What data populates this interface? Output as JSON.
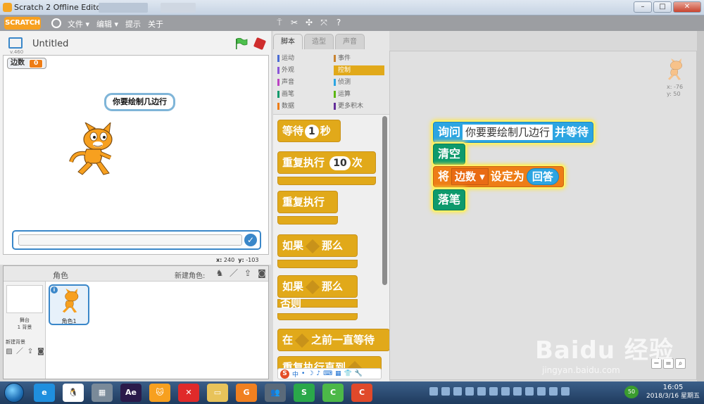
{
  "window": {
    "title": "Scratch 2 Offline Editor",
    "controls": [
      "–",
      "□",
      "✕"
    ]
  },
  "menubar": {
    "logo": "SCRATCH",
    "items": [
      "文件 ▾",
      "编辑 ▾",
      "提示",
      "关于"
    ],
    "tools": [
      "duplicate-icon",
      "delete-icon",
      "grow-icon",
      "shrink-icon",
      "help-icon"
    ]
  },
  "stage": {
    "project_title": "Untitled",
    "version": "v.460",
    "variable": {
      "name": "边数",
      "value": "0"
    },
    "speech_bubble": "你要绘制几边行",
    "coords": {
      "x_label": "x:",
      "x": "240",
      "y_label": "y:",
      "y": "-103"
    }
  },
  "sprites": {
    "label": "角色",
    "new_sprite_label": "新建角色:",
    "stage_name": "舞台",
    "backdrop_count": "1 背景",
    "new_backdrop_label": "新建背景",
    "sprite_list": [
      {
        "name": "角色1"
      }
    ]
  },
  "palette": {
    "tabs": [
      "脚本",
      "造型",
      "声音"
    ],
    "categories": [
      {
        "label": "运动",
        "color": "#4a6cd4"
      },
      {
        "label": "事件",
        "color": "#c88330"
      },
      {
        "label": "外观",
        "color": "#8a55d7"
      },
      {
        "label": "控制",
        "color": "#e1a91a"
      },
      {
        "label": "声音",
        "color": "#bb42c3"
      },
      {
        "label": "侦测",
        "color": "#2ca5e2"
      },
      {
        "label": "画笔",
        "color": "#0e9a6c"
      },
      {
        "label": "运算",
        "color": "#5cb712"
      },
      {
        "label": "数据",
        "color": "#ee7d16"
      },
      {
        "label": "更多积木",
        "color": "#632d99"
      }
    ],
    "selected_category": "控制",
    "blocks": {
      "wait": {
        "pre": "等待",
        "num": "1",
        "post": "秒"
      },
      "repeat": {
        "pre": "重复执行",
        "num": "10",
        "post": "次"
      },
      "forever": "重复执行",
      "if_then": {
        "pre": "如果",
        "post": "那么"
      },
      "if_else": {
        "pre": "如果",
        "post": "那么",
        "else": "否则"
      },
      "wait_until": {
        "pre": "在",
        "post": "之前一直等待"
      },
      "repeat_until": "重复执行直到"
    }
  },
  "ime": {
    "logo": "S",
    "items": [
      "中",
      "•",
      "☽",
      "♪",
      "⌨",
      "▦",
      "👕",
      "🔧"
    ]
  },
  "script": {
    "sprite_xy": {
      "x": "x: -76",
      "y": "y: 50"
    },
    "ask": {
      "label": "询问",
      "input": "你要要绘制几边行",
      "suffix": "并等待"
    },
    "clear": "清空",
    "set_var": {
      "label": "将",
      "var": "边数",
      "mid": "设定为",
      "reporter": "回答"
    },
    "pen_down": "落笔"
  },
  "watermark": {
    "brand": "Baidu 经验",
    "url": "jingyan.baidu.com"
  },
  "taskbar": {
    "apps": [
      {
        "name": "ie",
        "color": "#1f8fde",
        "glyph": "e"
      },
      {
        "name": "penguin",
        "color": "#ffffff",
        "glyph": "🐧"
      },
      {
        "name": "calculator",
        "color": "#7a8a99",
        "glyph": "▦"
      },
      {
        "name": "after-effects",
        "color": "#2a1a4a",
        "glyph": "Ae"
      },
      {
        "name": "scratch",
        "color": "#f7a01f",
        "glyph": "🐱"
      },
      {
        "name": "xmind",
        "color": "#e02a2a",
        "glyph": "✕"
      },
      {
        "name": "folder",
        "color": "#e8c35a",
        "glyph": "▭"
      },
      {
        "name": "browser-g",
        "color": "#f08020",
        "glyph": "G"
      },
      {
        "name": "people",
        "color": "#5a6a7a",
        "glyph": "👥"
      },
      {
        "name": "app-s",
        "color": "#2aa84a",
        "glyph": "S"
      },
      {
        "name": "app-c-green",
        "color": "#4cb848",
        "glyph": "C"
      },
      {
        "name": "app-c-red",
        "color": "#e0492a",
        "glyph": "C"
      }
    ],
    "tray_badge": "50",
    "time": "16:05",
    "date": "2018/3/16 星期五"
  }
}
